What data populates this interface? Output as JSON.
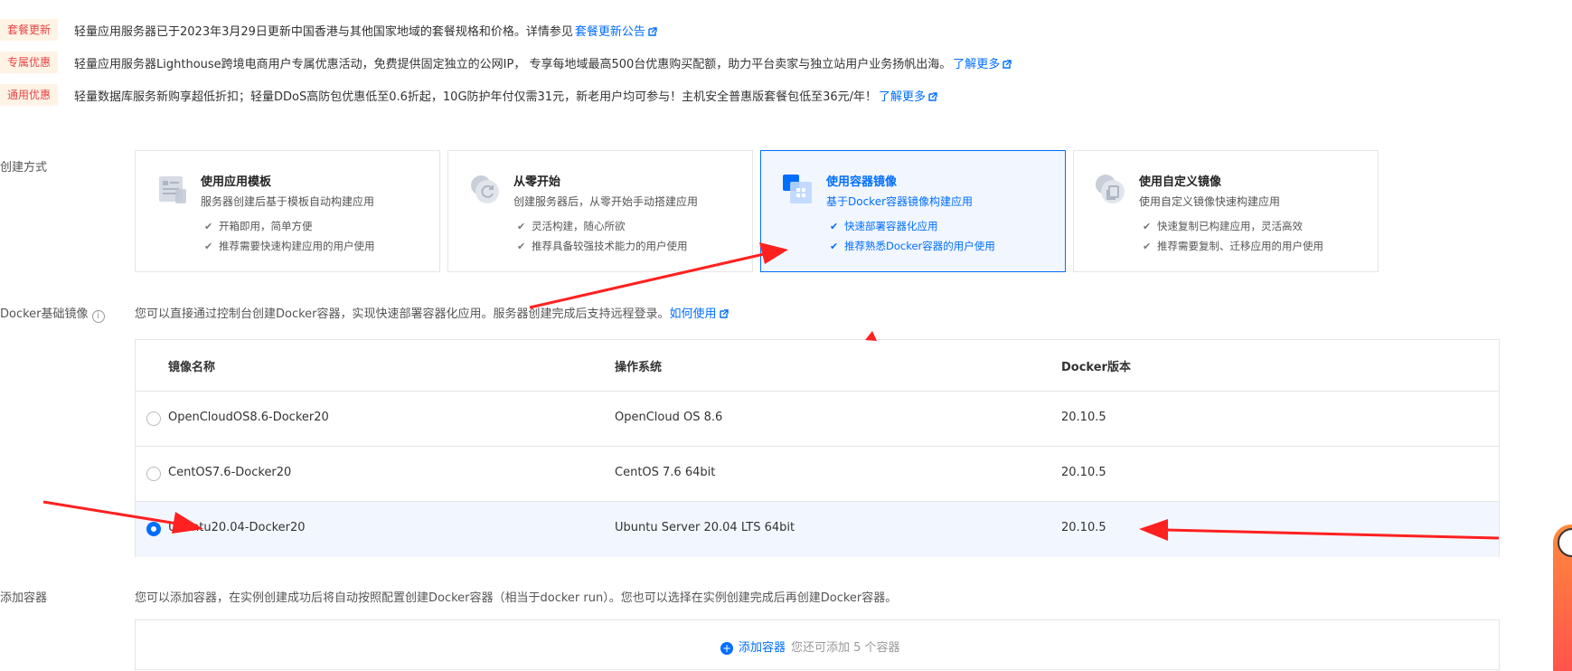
{
  "notices": [
    {
      "badge": "套餐更新",
      "text": "轻量应用服务器已于2023年3月29日更新中国香港与其他国家地域的套餐规格和价格。详情参见",
      "link": "套餐更新公告"
    },
    {
      "badge": "专属优惠",
      "text": "轻量应用服务器Lighthouse跨境电商用户专属优惠活动，免费提供固定独立的公网IP， 专享每地域最高500台优惠购买配额，助力平台卖家与独立站用户业务扬帆出海。",
      "link": "了解更多"
    },
    {
      "badge": "通用优惠",
      "text": "轻量数据库服务新购享超低折扣；轻量DDoS高防包优惠低至0.6折起，10G防护年付仅需31元，新老用户均可参与！主机安全普惠版套餐包低至36元/年！",
      "link": "了解更多"
    }
  ],
  "create_method": {
    "label": "创建方式",
    "cards": [
      {
        "title": "使用应用模板",
        "desc": "服务器创建后基于模板自动构建应用",
        "features": [
          "开箱即用，简单方便",
          "推荐需要快速构建应用的用户使用"
        ]
      },
      {
        "title": "从零开始",
        "desc": "创建服务器后，从零开始手动搭建应用",
        "features": [
          "灵活构建，随心所欲",
          "推荐具备较强技术能力的用户使用"
        ]
      },
      {
        "title": "使用容器镜像",
        "desc": "基于Docker容器镜像构建应用",
        "features": [
          "快速部署容器化应用",
          "推荐熟悉Docker容器的用户使用"
        ],
        "selected": true
      },
      {
        "title": "使用自定义镜像",
        "desc": "使用自定义镜像快速构建应用",
        "features": [
          "快速复制已构建应用，灵活高效",
          "推荐需要复制、迁移应用的用户使用"
        ]
      }
    ]
  },
  "docker_image": {
    "label": "Docker基础镜像",
    "info_icon": "i",
    "desc": "您可以直接通过控制台创建Docker容器，实现快速部署容器化应用。服务器创建完成后支持远程登录。",
    "link": "如何使用",
    "columns": [
      "镜像名称",
      "操作系统",
      "Docker版本"
    ],
    "rows": [
      {
        "name": "OpenCloudOS8.6-Docker20",
        "os": "OpenCloud OS 8.6",
        "version": "20.10.5",
        "selected": false
      },
      {
        "name": "CentOS7.6-Docker20",
        "os": "CentOS 7.6 64bit",
        "version": "20.10.5",
        "selected": false
      },
      {
        "name": "Ubuntu20.04-Docker20",
        "os": "Ubuntu Server 20.04 LTS 64bit",
        "version": "20.10.5",
        "selected": true
      }
    ]
  },
  "add_container": {
    "label": "添加容器",
    "desc": "您可以添加容器，在实例创建成功后将自动按照配置创建Docker容器（相当于docker run）。您也可以选择在实例创建完成后再创建Docker容器。",
    "button_label": "添加容器",
    "hint": "您还可添加 5 个容器"
  },
  "colors": {
    "accent": "#006eff",
    "badge_text": "#e54545",
    "badge_bg": "#fff3e6",
    "arrow": "#ff2020"
  }
}
